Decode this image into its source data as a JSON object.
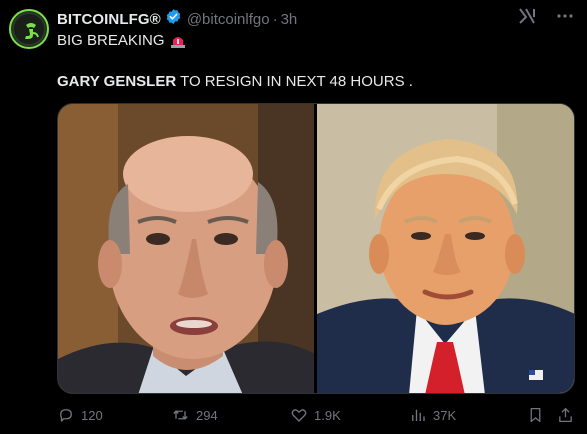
{
  "tweet": {
    "author_name": "BITCOINLFG®",
    "handle": "@bitcoinlfgo",
    "separator": "·",
    "time": "3h",
    "line1": "BIG BREAKING",
    "line2_bold": "GARY GENSLER",
    "line2_rest": " TO RESIGN IN NEXT 48 HOURS ."
  },
  "icons": {
    "avatar": "bitcoinlfg-logo-icon",
    "verified": "verified-badge-icon",
    "siren": "siren-emoji-icon",
    "grok": "grok-icon",
    "more": "more-icon",
    "reply": "reply-icon",
    "retweet": "retweet-icon",
    "like": "like-icon",
    "views": "views-icon",
    "bookmark": "bookmark-icon",
    "share": "share-icon"
  },
  "media": {
    "images": [
      "photo of Gary Gensler",
      "photo of Donald Trump"
    ]
  },
  "stats": {
    "replies": "120",
    "retweets": "294",
    "likes": "1.9K",
    "views": "37K"
  },
  "colors": {
    "background": "#000000",
    "text": "#e7e9ea",
    "muted": "#71767b",
    "verified": "#1d9bf0",
    "avatar_ring": "#7be04a"
  }
}
